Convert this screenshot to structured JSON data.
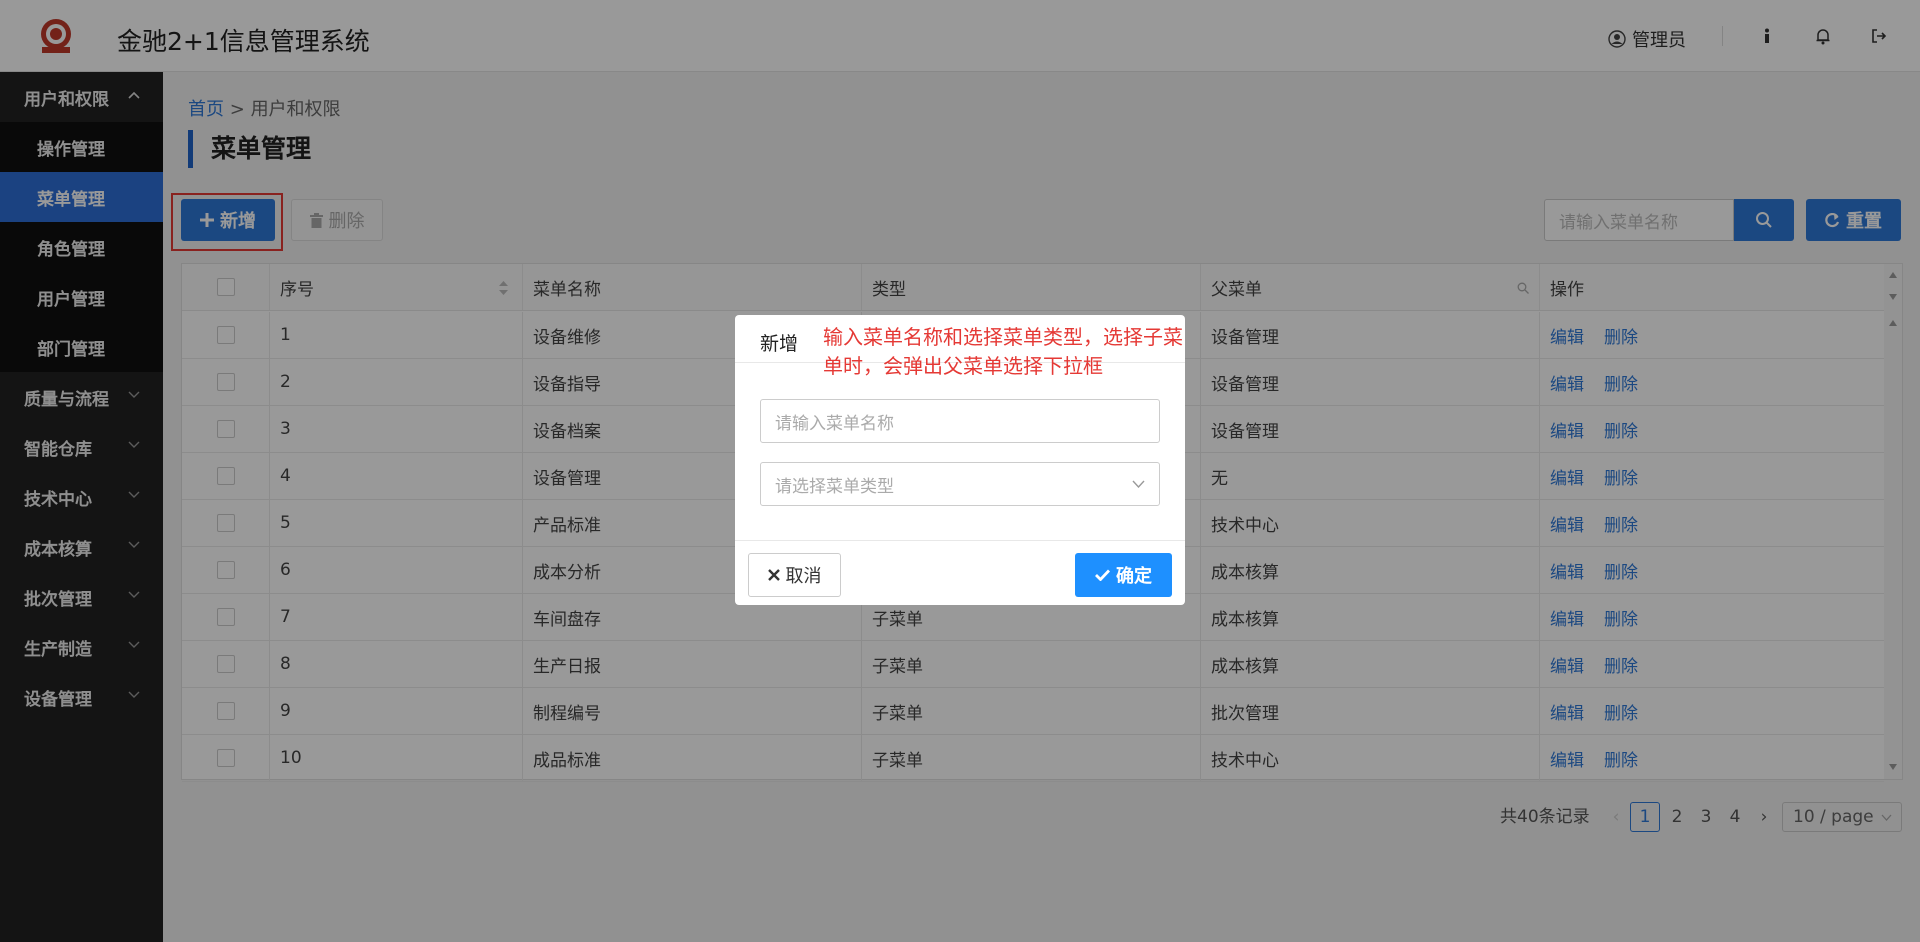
{
  "app": {
    "title": "金驰2+1信息管理系统",
    "user": "管理员"
  },
  "sidebar": {
    "groups": [
      {
        "label": "用户和权限",
        "expanded": true,
        "items": [
          "操作管理",
          "菜单管理",
          "角色管理",
          "用户管理",
          "部门管理"
        ],
        "active": "菜单管理"
      },
      {
        "label": "质量与流程"
      },
      {
        "label": "智能仓库"
      },
      {
        "label": "技术中心"
      },
      {
        "label": "成本核算"
      },
      {
        "label": "批次管理"
      },
      {
        "label": "生产制造"
      },
      {
        "label": "设备管理"
      }
    ]
  },
  "breadcrumb": {
    "home": "首页",
    "sep": ">",
    "current": "用户和权限"
  },
  "page": {
    "title": "菜单管理"
  },
  "toolbar": {
    "add_label": "新增",
    "delete_label": "删除",
    "search_placeholder": "请输入菜单名称",
    "reset_label": "重置"
  },
  "table": {
    "columns": [
      "序号",
      "菜单名称",
      "类型",
      "父菜单",
      "操作"
    ],
    "rows": [
      {
        "no": "1",
        "name": "设备维修",
        "type": "",
        "parent": "设备管理"
      },
      {
        "no": "2",
        "name": "设备指导",
        "type": "",
        "parent": "设备管理"
      },
      {
        "no": "3",
        "name": "设备档案",
        "type": "",
        "parent": "设备管理"
      },
      {
        "no": "4",
        "name": "设备管理",
        "type": "",
        "parent": "无"
      },
      {
        "no": "5",
        "name": "产品标准",
        "type": "",
        "parent": "技术中心"
      },
      {
        "no": "6",
        "name": "成本分析",
        "type": "",
        "parent": "成本核算"
      },
      {
        "no": "7",
        "name": "车间盘存",
        "type": "子菜单",
        "parent": "成本核算"
      },
      {
        "no": "8",
        "name": "生产日报",
        "type": "子菜单",
        "parent": "成本核算"
      },
      {
        "no": "9",
        "name": "制程编号",
        "type": "子菜单",
        "parent": "批次管理"
      },
      {
        "no": "10",
        "name": "成品标准",
        "type": "子菜单",
        "parent": "技术中心"
      }
    ],
    "edit_label": "编辑",
    "delete_label": "删除"
  },
  "pagination": {
    "total": "共40条记录",
    "pages": [
      "1",
      "2",
      "3",
      "4"
    ],
    "current": "1",
    "page_size": "10 / page"
  },
  "modal": {
    "title": "新增",
    "annotation": "输入菜单名称和选择菜单类型，选择子菜单时，会弹出父菜单选择下拉框",
    "name_placeholder": "请输入菜单名称",
    "type_placeholder": "请选择菜单类型",
    "cancel_label": "取消",
    "ok_label": "确定"
  },
  "colors": {
    "primary": "#2e78d8",
    "sidebar_bg": "#222222",
    "annotation": "#e53935"
  }
}
